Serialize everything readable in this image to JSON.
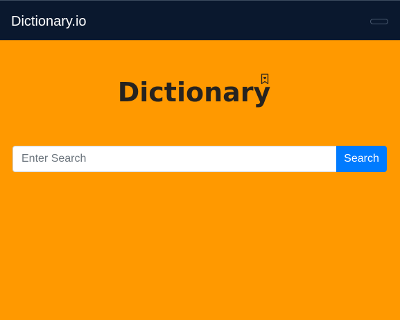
{
  "navbar": {
    "brand": "Dictionary.io",
    "background_color": "#0a182e",
    "toggler_icon": "menu-toggle-icon"
  },
  "main": {
    "background_color": "#ff9900",
    "title": "Dictionary",
    "title_icon": "bookmark-heart-icon",
    "search": {
      "placeholder": "Enter Search",
      "value": "",
      "button_label": "Search",
      "button_color": "#007bff"
    }
  }
}
